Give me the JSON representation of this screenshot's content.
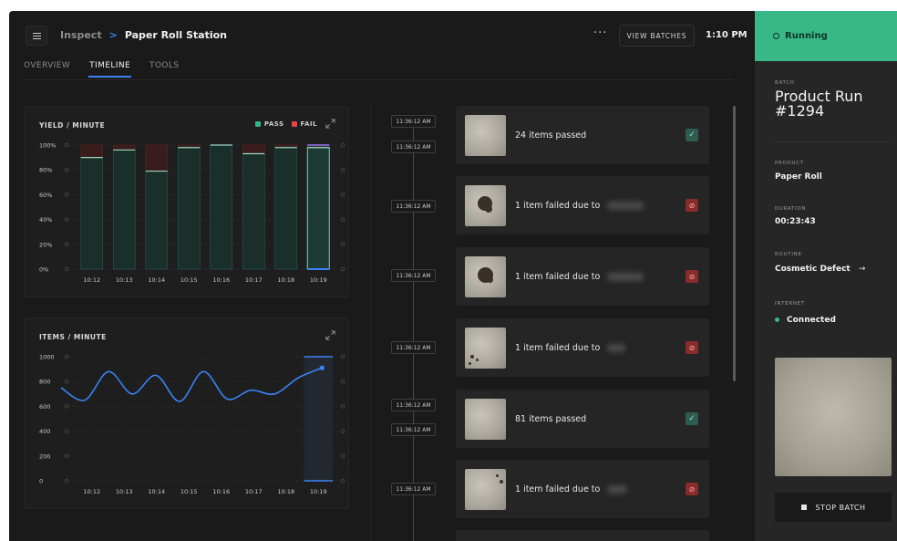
{
  "header": {
    "breadcrumb_parent": "Inspect",
    "breadcrumb_separator": ">",
    "breadcrumb_current": "Paper Roll Station",
    "more_label": "···",
    "view_batches_label": "VIEW BATCHES",
    "time": "1:10 PM"
  },
  "tabs": [
    {
      "label": "OVERVIEW",
      "active": false
    },
    {
      "label": "TIMELINE",
      "active": true
    },
    {
      "label": "TOOLS",
      "active": false
    }
  ],
  "yield_chart": {
    "title": "YIELD / MINUTE",
    "legend_pass": "PASS",
    "legend_fail": "FAIL"
  },
  "items_chart": {
    "title": "ITEMS / MINUTE"
  },
  "chart_data": [
    {
      "type": "bar",
      "title": "YIELD / MINUTE",
      "categories": [
        "10:12",
        "10:13",
        "10:14",
        "10:15",
        "10:16",
        "10:17",
        "10:18",
        "10:19"
      ],
      "series": [
        {
          "name": "PASS",
          "values": [
            90,
            96,
            79,
            98,
            100,
            93,
            98,
            98
          ]
        },
        {
          "name": "FAIL",
          "values": [
            10,
            4,
            21,
            2,
            0,
            7,
            2,
            2
          ]
        }
      ],
      "y_ticks": [
        "100%",
        "80%",
        "60%",
        "40%",
        "20%",
        "0%"
      ],
      "ylim": [
        0,
        100
      ],
      "colors": {
        "pass": "#2fb58a",
        "fail": "#e04848"
      }
    },
    {
      "type": "line",
      "title": "ITEMS / MINUTE",
      "x": [
        "10:12",
        "10:13",
        "10:14",
        "10:15",
        "10:16",
        "10:17",
        "10:18",
        "10:19"
      ],
      "series": [
        {
          "values": [
            750,
            650,
            880,
            700,
            850,
            640,
            880,
            660,
            730,
            700,
            830,
            910
          ]
        }
      ],
      "y_ticks": [
        "1000",
        "800",
        "600",
        "400",
        "200",
        "0"
      ],
      "ylim": [
        0,
        1000
      ],
      "color": "#3b82f6"
    }
  ],
  "timeline": {
    "times": [
      "11:36:12 AM",
      "11:36:12 AM",
      "11:36:12 AM",
      "11:36:12 AM",
      "11:36:12 AM",
      "11:36:12 AM",
      "11:36:12 AM",
      "11:36:12 AM"
    ],
    "events": [
      {
        "text": "24 items passed",
        "status": "pass"
      },
      {
        "text": "1 item failed due to",
        "status": "fail"
      },
      {
        "text": "1 item failed due to",
        "status": "fail"
      },
      {
        "text": "1 item failed due to",
        "status": "fail"
      },
      {
        "text": "81 items passed",
        "status": "pass"
      },
      {
        "text": "1 item failed due to",
        "status": "fail"
      }
    ]
  },
  "panel": {
    "status": "Running",
    "batch_label": "BATCH",
    "batch_name": "Product Run #1294",
    "product_label": "PRODUCT",
    "product_value": "Paper Roll",
    "duration_label": "DURATION",
    "duration_value": "00:23:43",
    "routine_label": "ROUTINE",
    "routine_value": "Cosmetic Defect",
    "routine_arrow": "→",
    "internet_label": "INTERNET",
    "internet_value": "Connected",
    "stop_label": "STOP BATCH",
    "accent": "#38b887"
  }
}
